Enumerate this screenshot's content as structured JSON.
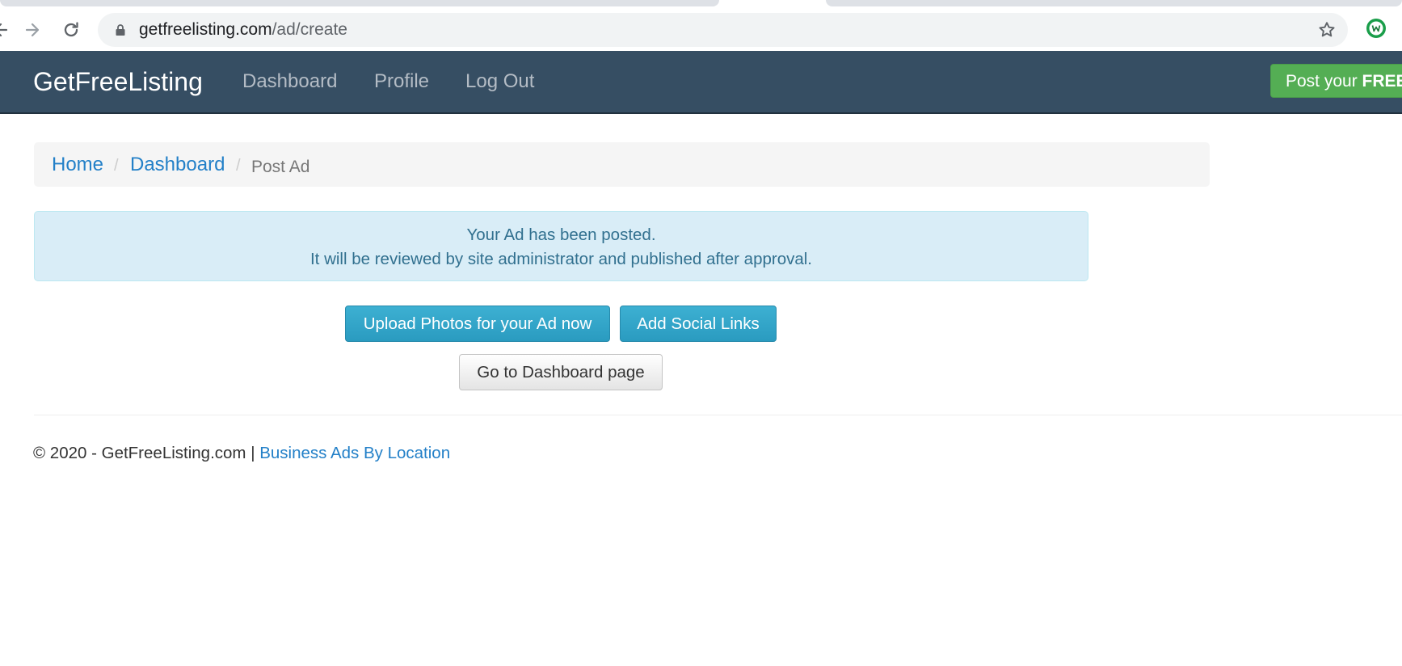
{
  "browser": {
    "url_host": "getfreelisting.com",
    "url_path": "/ad/create"
  },
  "navbar": {
    "brand": "GetFreeListing",
    "links": [
      "Dashboard",
      "Profile",
      "Log Out"
    ],
    "cta_prefix": "Post your ",
    "cta_bold": "FREE"
  },
  "breadcrumb": {
    "home": "Home",
    "dashboard": "Dashboard",
    "current": "Post Ad",
    "separator": "/"
  },
  "alert": {
    "line1": "Your Ad has been posted.",
    "line2": "It will be reviewed by site administrator and published after approval."
  },
  "actions": {
    "upload_photos": "Upload Photos for your Ad now",
    "add_social": "Add Social Links",
    "go_dashboard": "Go to Dashboard page"
  },
  "footer": {
    "copyright": "© 2020 - GetFreeListing.com | ",
    "link": "Business Ads By Location"
  },
  "colors": {
    "navbar_bg": "#364e63",
    "link": "#2380c8",
    "alert_bg": "#d9edf7",
    "alert_text": "#31708f",
    "btn_info": "#2fa4c8",
    "btn_success": "#54ae54"
  }
}
